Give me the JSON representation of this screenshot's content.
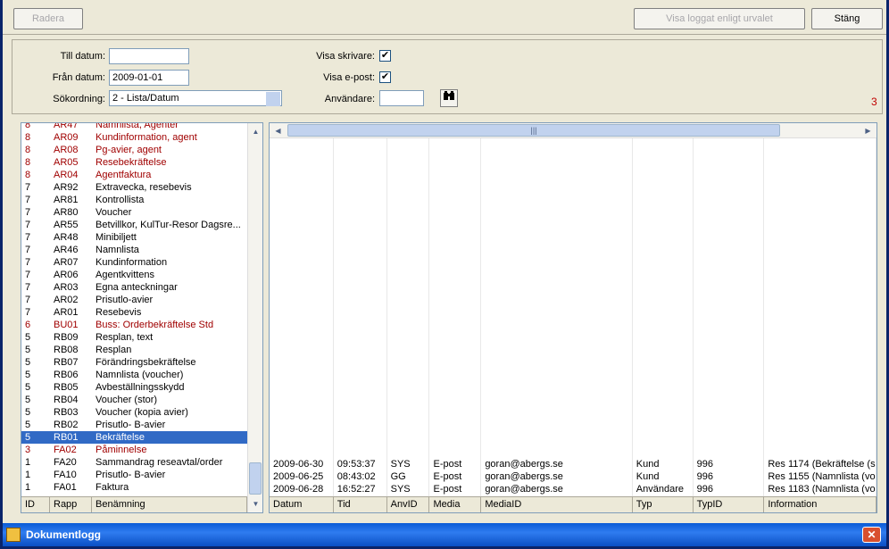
{
  "window": {
    "title": "Dokumentlogg",
    "close_glyph": "✕"
  },
  "toolbar": {
    "radera_label": "Radera",
    "visa_loggat_label": "Visa loggat enligt urvalet",
    "stang_label": "Stäng"
  },
  "filters": {
    "till_datum_label": "Till datum:",
    "till_datum_value": "",
    "fran_datum_label": "Från datum:",
    "fran_datum_value": "2009-01-01",
    "sortering_label": "Sökordning:",
    "sortering_value": "2 - Lista/Datum",
    "visa_skrivare_label": "Visa skrivare:",
    "visa_skrivare_checked": "✔",
    "visa_epost_label": "Visa e-post:",
    "visa_epost_checked": "✔",
    "anvandare_label": "Användare:",
    "anvandare_value": "",
    "count": "3"
  },
  "list": {
    "headers": {
      "id": "ID",
      "rapp": "Rapp",
      "benamning": "Benämning"
    },
    "rows": [
      {
        "id": "1",
        "rapp": "FA01",
        "name": "Faktura",
        "style": ""
      },
      {
        "id": "1",
        "rapp": "FA10",
        "name": "Prisutlo- B-avier",
        "style": ""
      },
      {
        "id": "1",
        "rapp": "FA20",
        "name": "Sammandrag reseavtal/order",
        "style": ""
      },
      {
        "id": "3",
        "rapp": "FA02",
        "name": "Påminnelse",
        "style": "red"
      },
      {
        "id": "5",
        "rapp": "RB01",
        "name": "Bekräftelse",
        "style": "sel"
      },
      {
        "id": "5",
        "rapp": "RB02",
        "name": "Prisutlo- B-avier",
        "style": ""
      },
      {
        "id": "5",
        "rapp": "RB03",
        "name": "Voucher (kopia avier)",
        "style": ""
      },
      {
        "id": "5",
        "rapp": "RB04",
        "name": "Voucher (stor)",
        "style": ""
      },
      {
        "id": "5",
        "rapp": "RB05",
        "name": "Avbeställningsskydd",
        "style": ""
      },
      {
        "id": "5",
        "rapp": "RB06",
        "name": "Namnlista (voucher)",
        "style": ""
      },
      {
        "id": "5",
        "rapp": "RB07",
        "name": "Förändringsbekräftelse",
        "style": ""
      },
      {
        "id": "5",
        "rapp": "RB08",
        "name": "Resplan",
        "style": ""
      },
      {
        "id": "5",
        "rapp": "RB09",
        "name": "Resplan, text",
        "style": ""
      },
      {
        "id": "6",
        "rapp": "BU01",
        "name": "Buss: Orderbekräftelse Std",
        "style": "red"
      },
      {
        "id": "7",
        "rapp": "AR01",
        "name": "Resebevis",
        "style": ""
      },
      {
        "id": "7",
        "rapp": "AR02",
        "name": "Prisutlo-avier",
        "style": ""
      },
      {
        "id": "7",
        "rapp": "AR03",
        "name": "Egna anteckningar",
        "style": ""
      },
      {
        "id": "7",
        "rapp": "AR06",
        "name": "Agentkvittens",
        "style": ""
      },
      {
        "id": "7",
        "rapp": "AR07",
        "name": "Kundinformation",
        "style": ""
      },
      {
        "id": "7",
        "rapp": "AR46",
        "name": "Namnlista",
        "style": ""
      },
      {
        "id": "7",
        "rapp": "AR48",
        "name": "Minibiljett",
        "style": ""
      },
      {
        "id": "7",
        "rapp": "AR55",
        "name": "Betvillkor, KulTur-Resor Dagsre...",
        "style": ""
      },
      {
        "id": "7",
        "rapp": "AR80",
        "name": "Voucher",
        "style": ""
      },
      {
        "id": "7",
        "rapp": "AR81",
        "name": "Kontrollista",
        "style": ""
      },
      {
        "id": "7",
        "rapp": "AR92",
        "name": "Extravecka, resebevis",
        "style": ""
      },
      {
        "id": "8",
        "rapp": "AR04",
        "name": "Agentfaktura",
        "style": "red"
      },
      {
        "id": "8",
        "rapp": "AR05",
        "name": "Resebekräftelse",
        "style": "red"
      },
      {
        "id": "8",
        "rapp": "AR08",
        "name": "Pg-avier, agent",
        "style": "red"
      },
      {
        "id": "8",
        "rapp": "AR09",
        "name": "Kundinformation, agent",
        "style": "red"
      },
      {
        "id": "8",
        "rapp": "AR47",
        "name": "Namnlista, Agenter",
        "style": "red"
      }
    ]
  },
  "log": {
    "headers": [
      "Datum",
      "Tid",
      "AnvID",
      "Media",
      "MediaID",
      "Typ",
      "TypID",
      "Information"
    ],
    "rows": [
      [
        "2009-06-30",
        "09:53:37",
        "SYS",
        "E-post",
        "goran@abergs.se",
        "Kund",
        "996",
        "Res 1174 (Bekräftelse (s"
      ],
      [
        "2009-06-25",
        "08:43:02",
        "GG",
        "E-post",
        "goran@abergs.se",
        "Kund",
        "996",
        "Res 1155 (Namnlista (vo"
      ],
      [
        "2009-06-28",
        "16:52:27",
        "SYS",
        "E-post",
        "goran@abergs.se",
        "Användare",
        "996",
        "Res 1183 (Namnlista (vo"
      ]
    ]
  },
  "icons": {
    "binoculars": "binoculars-icon",
    "scroll_up": "▲",
    "scroll_down": "▼",
    "scroll_left": "◀",
    "scroll_right": "▶",
    "grip": "|||"
  }
}
